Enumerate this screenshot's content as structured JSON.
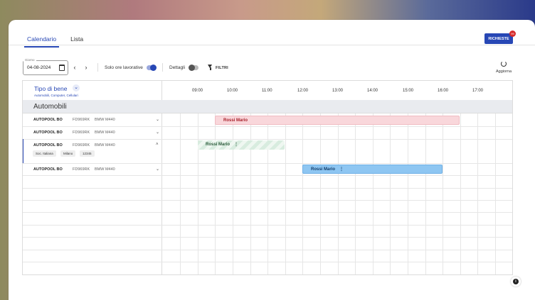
{
  "tabs": [
    {
      "label": "Calendario",
      "active": true
    },
    {
      "label": "Lista",
      "active": false
    }
  ],
  "requests": {
    "label": "RICHIESTE",
    "badge": "99"
  },
  "toolbar": {
    "date_label": "Giorno",
    "date_value": "04-08-2024",
    "prev_icon": "chevron-left-icon",
    "next_icon": "chevron-right-icon",
    "working_hours_label": "Solo ore lavorative",
    "working_hours_on": true,
    "details_label": "Dettagli",
    "details_on": false,
    "filter_label": "FILTRI",
    "refresh_label": "Aggiorna"
  },
  "header": {
    "type_title": "Tipo di bene",
    "type_subtitle": "Automobili, Computer, Cellulari",
    "hours": [
      "09:00",
      "10:00",
      "11:00",
      "12:00",
      "13:00",
      "14:00",
      "15:00",
      "16:00",
      "17:00"
    ]
  },
  "section": {
    "title": "Automobili"
  },
  "rows": [
    {
      "pool": "AUTOPOOL BO",
      "plate": "FD969RK",
      "model": "BMW M440",
      "expanded": false
    },
    {
      "pool": "AUTOPOOL BO",
      "plate": "FD969RK",
      "model": "BMW M440",
      "expanded": false
    },
    {
      "pool": "AUTOPOOL BO",
      "plate": "FD969RK",
      "model": "BMW M440",
      "expanded": true,
      "chips": [
        "Soc. Italiana",
        "Milano",
        "12345"
      ]
    },
    {
      "pool": "AUTOPOOL BO",
      "plate": "FD969RK",
      "model": "BMW M440",
      "expanded": false
    }
  ],
  "events": [
    {
      "label": "Rossi Mario",
      "style": "pink",
      "row": 0
    },
    {
      "label": "Rossi Mario",
      "style": "green",
      "row": 2,
      "menu": "⋮"
    },
    {
      "label": "Rossi Mario",
      "style": "blue",
      "row": 3,
      "menu": "⋮"
    }
  ],
  "colors": {
    "accent": "#2747b5",
    "pink": "#f9d7db",
    "green": "#d8ecdf",
    "blue": "#8ec6f2"
  }
}
